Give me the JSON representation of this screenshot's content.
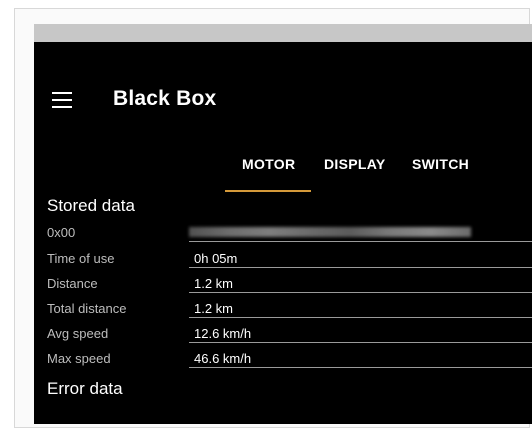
{
  "app": {
    "title": "Black Box"
  },
  "icons": {
    "menu": "hamburger-menu-icon"
  },
  "tabs": [
    {
      "label": "MOTOR",
      "active": true
    },
    {
      "label": "DISPLAY",
      "active": false
    },
    {
      "label": "SWITCH",
      "active": false
    }
  ],
  "accent_color": "#d59a3a",
  "stored": {
    "title": "Stored data",
    "address_label": "0x00",
    "rows": [
      {
        "label": "Time of use",
        "value": "0h 05m"
      },
      {
        "label": "Distance",
        "value": "1.2 km"
      },
      {
        "label": "Total distance",
        "value": "1.2 km"
      },
      {
        "label": "Avg speed",
        "value": "12.6 km/h"
      },
      {
        "label": "Max speed",
        "value": "46.6 km/h"
      }
    ]
  },
  "error": {
    "title": "Error data"
  }
}
